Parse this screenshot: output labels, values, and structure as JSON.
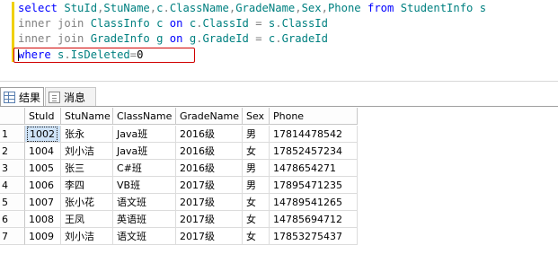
{
  "sql": {
    "line1": [
      {
        "t": "select",
        "c": "kw"
      },
      {
        "t": " ",
        "c": "txt"
      },
      {
        "t": "StuId",
        "c": "id"
      },
      {
        "t": ",",
        "c": "op"
      },
      {
        "t": "StuName",
        "c": "id"
      },
      {
        "t": ",",
        "c": "op"
      },
      {
        "t": "c",
        "c": "id"
      },
      {
        "t": ".",
        "c": "op"
      },
      {
        "t": "ClassName",
        "c": "id"
      },
      {
        "t": ",",
        "c": "op"
      },
      {
        "t": "GradeName",
        "c": "id"
      },
      {
        "t": ",",
        "c": "op"
      },
      {
        "t": "Sex",
        "c": "id"
      },
      {
        "t": ",",
        "c": "op"
      },
      {
        "t": "Phone",
        "c": "id"
      },
      {
        "t": " ",
        "c": "txt"
      },
      {
        "t": "from",
        "c": "kw"
      },
      {
        "t": " ",
        "c": "txt"
      },
      {
        "t": "StudentInfo",
        "c": "id"
      },
      {
        "t": " ",
        "c": "txt"
      },
      {
        "t": "s",
        "c": "id"
      }
    ],
    "line2": [
      {
        "t": "inner join",
        "c": "op"
      },
      {
        "t": " ",
        "c": "txt"
      },
      {
        "t": "ClassInfo",
        "c": "id"
      },
      {
        "t": " ",
        "c": "txt"
      },
      {
        "t": "c",
        "c": "id"
      },
      {
        "t": " ",
        "c": "txt"
      },
      {
        "t": "on",
        "c": "kw"
      },
      {
        "t": " ",
        "c": "txt"
      },
      {
        "t": "c",
        "c": "id"
      },
      {
        "t": ".",
        "c": "op"
      },
      {
        "t": "ClassId",
        "c": "id"
      },
      {
        "t": " ",
        "c": "txt"
      },
      {
        "t": "=",
        "c": "op"
      },
      {
        "t": " ",
        "c": "txt"
      },
      {
        "t": "s",
        "c": "id"
      },
      {
        "t": ".",
        "c": "op"
      },
      {
        "t": "ClassId",
        "c": "id"
      }
    ],
    "line3": [
      {
        "t": "inner join",
        "c": "op"
      },
      {
        "t": " ",
        "c": "txt"
      },
      {
        "t": "GradeInfo",
        "c": "id"
      },
      {
        "t": " ",
        "c": "txt"
      },
      {
        "t": "g",
        "c": "id"
      },
      {
        "t": " ",
        "c": "txt"
      },
      {
        "t": "on",
        "c": "kw"
      },
      {
        "t": " ",
        "c": "txt"
      },
      {
        "t": "g",
        "c": "id"
      },
      {
        "t": ".",
        "c": "op"
      },
      {
        "t": "GradeId",
        "c": "id"
      },
      {
        "t": " ",
        "c": "txt"
      },
      {
        "t": "=",
        "c": "op"
      },
      {
        "t": " ",
        "c": "txt"
      },
      {
        "t": "c",
        "c": "id"
      },
      {
        "t": ".",
        "c": "op"
      },
      {
        "t": "GradeId",
        "c": "id"
      }
    ],
    "line4": [
      {
        "t": "where",
        "c": "kw"
      },
      {
        "t": " ",
        "c": "txt"
      },
      {
        "t": "s",
        "c": "id"
      },
      {
        "t": ".",
        "c": "op"
      },
      {
        "t": "IsDeleted",
        "c": "id"
      },
      {
        "t": "=",
        "c": "op"
      },
      {
        "t": "0",
        "c": "txt"
      }
    ]
  },
  "colors": {
    "keyword": "#0000ff",
    "identifier": "#008080",
    "operator": "#808080",
    "highlight_border": "#d00000",
    "selected_cell": "#cfe3f7"
  },
  "tabs": {
    "results": {
      "label": "结果",
      "icon": "grid-icon"
    },
    "messages": {
      "label": "消息",
      "icon": "message-icon"
    }
  },
  "grid": {
    "columns": [
      "StuId",
      "StuName",
      "ClassName",
      "GradeName",
      "Sex",
      "Phone"
    ],
    "rows": [
      {
        "n": "1",
        "cells": [
          "1002",
          "张永",
          "Java班",
          "2016级",
          "男",
          "17814478542"
        ]
      },
      {
        "n": "2",
        "cells": [
          "1004",
          "刘小洁",
          "Java班",
          "2016级",
          "女",
          "17852457234"
        ]
      },
      {
        "n": "3",
        "cells": [
          "1005",
          "张三",
          "C#班",
          "2016级",
          "男",
          "1478654271"
        ]
      },
      {
        "n": "4",
        "cells": [
          "1006",
          "李四",
          "VB班",
          "2017级",
          "男",
          "17895471235"
        ]
      },
      {
        "n": "5",
        "cells": [
          "1007",
          "张小花",
          "语文班",
          "2017级",
          "女",
          "14789541265"
        ]
      },
      {
        "n": "6",
        "cells": [
          "1008",
          "王凤",
          "英语班",
          "2017级",
          "女",
          "14785694712"
        ]
      },
      {
        "n": "7",
        "cells": [
          "1009",
          "刘小洁",
          "语文班",
          "2017级",
          "女",
          "17853275437"
        ]
      }
    ],
    "selected": {
      "row": 0,
      "col": 0
    }
  }
}
